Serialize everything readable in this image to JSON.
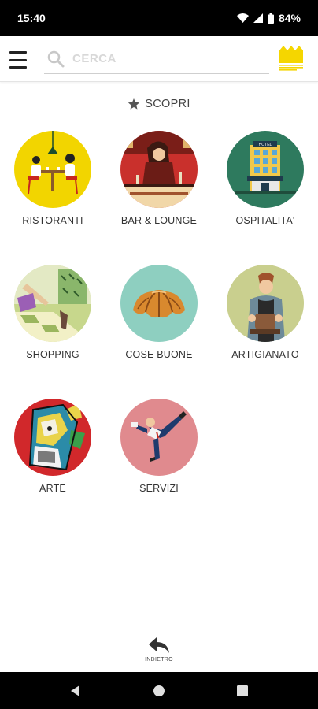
{
  "status_bar": {
    "time": "15:40",
    "battery": "84%"
  },
  "header": {
    "search": {
      "placeholder": "CERCA",
      "value": ""
    },
    "brand_color": "#f5d600"
  },
  "section": {
    "title": "SCOPRI",
    "icon": "star-icon"
  },
  "categories": [
    {
      "label": "RISTORANTI",
      "icon": "restaurant-illustration",
      "bg": "#f2d500"
    },
    {
      "label": "BAR & LOUNGE",
      "icon": "bar-lounge-illustration",
      "bg": "#c9302c"
    },
    {
      "label": "OSPITALITA'",
      "icon": "hotel-illustration",
      "bg": "#2e7a5e"
    },
    {
      "label": "SHOPPING",
      "icon": "shopping-illustration",
      "bg": "#c7d78c"
    },
    {
      "label": "COSE BUONE",
      "icon": "croissant-illustration",
      "bg": "#8ecfc0"
    },
    {
      "label": "ARTIGIANATO",
      "icon": "artisan-illustration",
      "bg": "#c9cf8e"
    },
    {
      "label": "ARTE",
      "icon": "art-illustration",
      "bg": "#d1282b"
    },
    {
      "label": "SERVIZI",
      "icon": "services-illustration",
      "bg": "#e08a8e"
    }
  ],
  "footer": {
    "back_label": "INDIETRO",
    "icon": "back-arrow-icon"
  },
  "nav": {
    "back": "nav-back-icon",
    "home": "nav-home-icon",
    "recents": "nav-recents-icon"
  }
}
